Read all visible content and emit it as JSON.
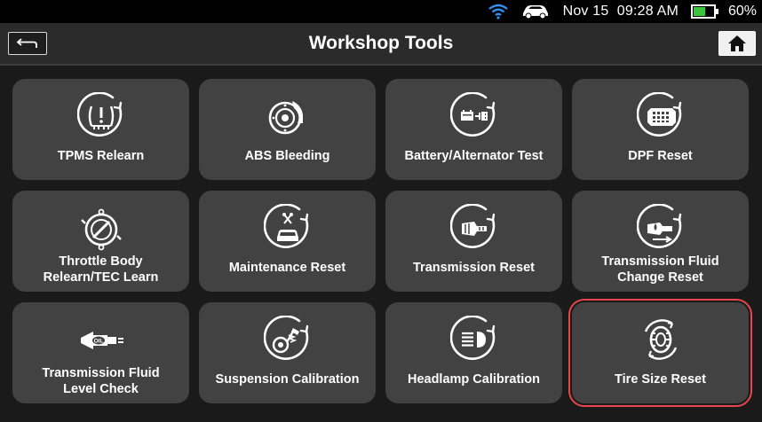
{
  "status": {
    "date": "Nov 15",
    "time": "09:28 AM",
    "battery": "60%",
    "battery_level": 0.6,
    "icons": [
      "wifi-icon",
      "car-connection-icon",
      "battery-icon"
    ],
    "colors": {
      "battery_fill": "#3cc43c"
    }
  },
  "header": {
    "title": "Workshop Tools",
    "back_icon": "back-arrow-icon",
    "home_icon": "home-icon"
  },
  "tiles": [
    {
      "label": "TPMS Relearn",
      "icon": "tpms-icon"
    },
    {
      "label": "ABS Bleeding",
      "icon": "abs-brake-icon"
    },
    {
      "label": "Battery/Alternator Test",
      "icon": "battery-test-icon"
    },
    {
      "label": "DPF Reset",
      "icon": "dpf-filter-icon"
    },
    {
      "label": "Throttle Body\nRelearn/TEC Learn",
      "icon": "throttle-body-icon"
    },
    {
      "label": "Maintenance Reset",
      "icon": "maintenance-car-icon"
    },
    {
      "label": "Transmission Reset",
      "icon": "transmission-icon"
    },
    {
      "label": "Transmission Fluid\nChange Reset",
      "icon": "transmission-fluid-icon"
    },
    {
      "label": "Transmission Fluid\nLevel Check",
      "icon": "oil-level-icon"
    },
    {
      "label": "Suspension Calibration",
      "icon": "suspension-icon"
    },
    {
      "label": "Headlamp Calibration",
      "icon": "headlamp-icon"
    },
    {
      "label": "Tire Size Reset",
      "icon": "tire-icon",
      "selected": true
    }
  ],
  "colors": {
    "tile_bg": "#424242",
    "selected_border": "#e8464c",
    "page_bg": "#1a1a1a"
  }
}
